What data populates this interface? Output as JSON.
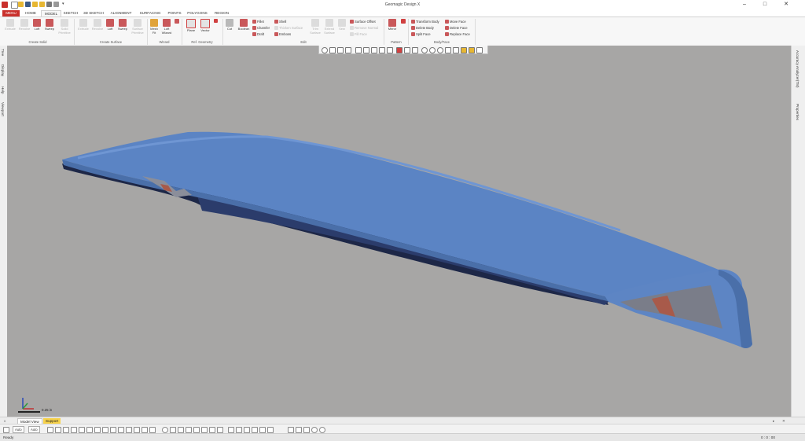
{
  "window": {
    "title": "Geomagic Design X"
  },
  "colors": {
    "accent": "#c9302c",
    "viewport_bg": "#a7a6a5",
    "model": "#5b84c4",
    "support_tab": "#f7d24a"
  },
  "tabs": [
    {
      "label": "MENU"
    },
    {
      "label": "HOME"
    },
    {
      "label": "MODEL"
    },
    {
      "label": "SKETCH"
    },
    {
      "label": "3D SKETCH"
    },
    {
      "label": "ALIGNMENT"
    },
    {
      "label": "SURFACING"
    },
    {
      "label": "POINTS"
    },
    {
      "label": "POLYGONS"
    },
    {
      "label": "REGION"
    }
  ],
  "ribbon": {
    "groups": [
      "Create Solid",
      "Create Surface",
      "Wizard",
      "Ref. Geometry",
      "Edit",
      "Pattern",
      "Body/Face"
    ],
    "create_solid": [
      "Extrude",
      "Revolve",
      "Loft",
      "Sweep",
      "Solid Primitive"
    ],
    "create_surface": [
      "Extrude",
      "Revolve",
      "Loft",
      "Sweep",
      "Surface Primitive"
    ],
    "wizard": [
      "Mesh Fit",
      "Loft Wizard"
    ],
    "ref_geometry": [
      "Plane",
      "Vector"
    ],
    "edit_big": [
      "Cut",
      "Boolean"
    ],
    "edit_small_col1": [
      "Fillet",
      "Chamfer",
      "Draft"
    ],
    "edit_small_col2": [
      "Shell",
      "Thicken Surface",
      "Emboss"
    ],
    "edit_big2": [
      "Trim Surface",
      "Extend Surface",
      "Sew"
    ],
    "edit_small_col3": [
      "Surface Offset",
      "Remove Normal",
      "Fill Face"
    ],
    "pattern": [
      "Mirror"
    ],
    "bodyface_col1": [
      "Transform Body",
      "Delete Body",
      "Split Face"
    ],
    "bodyface_col2": [
      "Move Face",
      "Delete Face",
      "Replace Face"
    ]
  },
  "left_panel": [
    "Tree",
    "Display",
    "Help",
    "Viewport"
  ],
  "right_panel": [
    "Accuracy Analyzer(TM)",
    "Properties"
  ],
  "viewport": {
    "scale_label": "0.25 in"
  },
  "bottom_tabs": [
    {
      "label": "Model View"
    },
    {
      "label": "Support"
    }
  ],
  "toolrow": {
    "select1": "Auto",
    "select2": "Auto"
  },
  "status": {
    "text": "Ready",
    "right": "0 : 0 : 00"
  }
}
